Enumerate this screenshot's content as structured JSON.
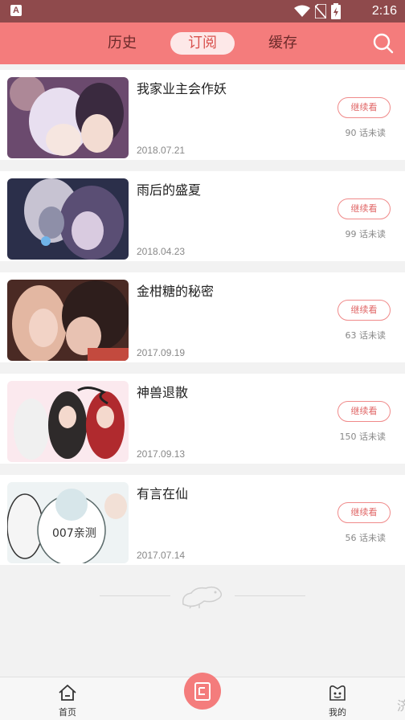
{
  "status_bar": {
    "time": "2:16",
    "app_badge": "A"
  },
  "header": {
    "tabs": [
      {
        "label": "历史",
        "active": false
      },
      {
        "label": "订阅",
        "active": true
      },
      {
        "label": "缓存",
        "active": false
      }
    ]
  },
  "subscriptions": [
    {
      "title": "我家业主会作妖",
      "date": "2018.07.21",
      "action": "继续看",
      "unread": "90 话未读",
      "palette": [
        "#6b4a6e",
        "#e8dff0",
        "#3a2a3f",
        "#c9a3a8"
      ]
    },
    {
      "title": "雨后的盛夏",
      "date": "2018.04.23",
      "action": "继续看",
      "unread": "99 话未读",
      "palette": [
        "#2b2f4a",
        "#8e8fa8",
        "#5a4e74",
        "#c7c3d2"
      ]
    },
    {
      "title": "金柑糖的秘密",
      "date": "2017.09.19",
      "action": "继续看",
      "unread": "63 话未读",
      "palette": [
        "#4a2a24",
        "#e3b7a2",
        "#c34a3e",
        "#2e1e1c"
      ]
    },
    {
      "title": "神兽退散",
      "date": "2017.09.13",
      "action": "继续看",
      "unread": "150 话未读",
      "palette": [
        "#fbe9ee",
        "#b02a2e",
        "#2e2a2a",
        "#f0f0f0"
      ]
    },
    {
      "title": "有言在仙",
      "date": "2017.07.14",
      "action": "继续看",
      "unread": "56 话未读",
      "palette": [
        "#eef3f4",
        "#5a6a6a",
        "#d7e6ea",
        "#333333"
      ],
      "overlay_text": "007亲测"
    }
  ],
  "bottom_nav": {
    "items": [
      {
        "label": "首页",
        "icon": "home-icon"
      },
      {
        "label": "",
        "icon": "bookshelf-icon"
      },
      {
        "label": "我的",
        "icon": "profile-icon"
      }
    ],
    "edge_glyph": "济"
  },
  "colors": {
    "accent": "#f47c7c",
    "status_bar": "#8f4a4c",
    "button_border": "#f08a8a"
  }
}
